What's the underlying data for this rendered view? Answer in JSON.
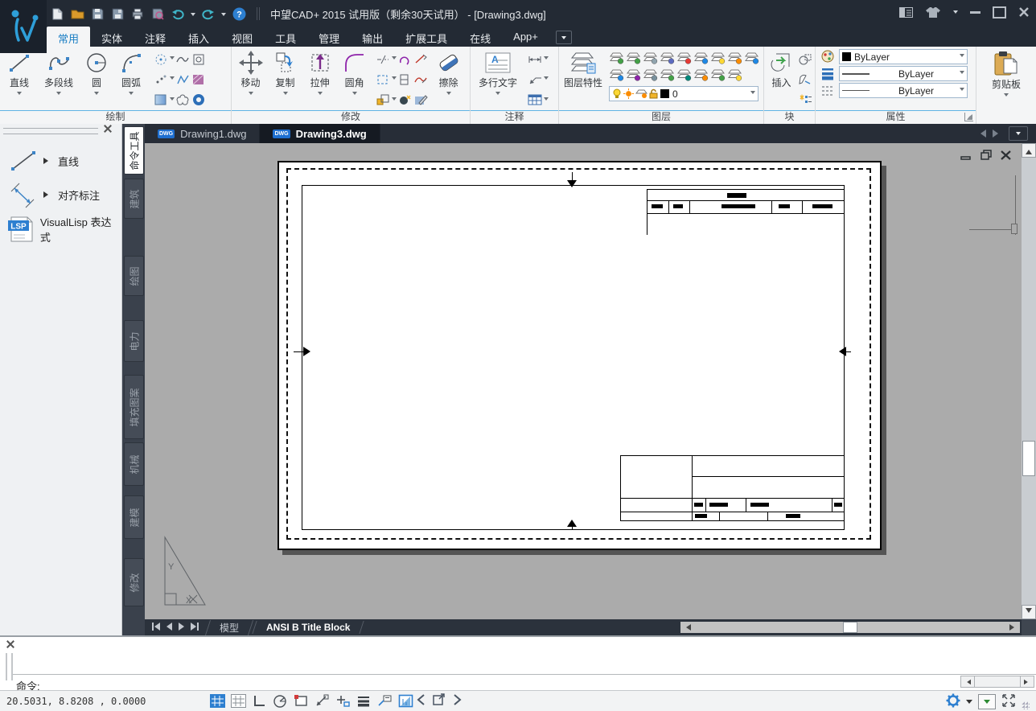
{
  "window": {
    "title": "中望CAD+ 2015 试用版（剩余30天试用） - [Drawing3.dwg]"
  },
  "icons": {
    "help": "?",
    "lsp": "LSP",
    "dwg": "DWG",
    "mtext_a": "A",
    "axis_y": "Y",
    "axis_x": "X"
  },
  "ribbon": {
    "tabs": [
      {
        "id": "home",
        "label": "常用",
        "active": true
      },
      {
        "id": "solid",
        "label": "实体"
      },
      {
        "id": "annotate",
        "label": "注释"
      },
      {
        "id": "insert",
        "label": "插入"
      },
      {
        "id": "view",
        "label": "视图"
      },
      {
        "id": "tools",
        "label": "工具"
      },
      {
        "id": "manage",
        "label": "管理"
      },
      {
        "id": "output",
        "label": "输出"
      },
      {
        "id": "express",
        "label": "扩展工具"
      },
      {
        "id": "online",
        "label": "在线"
      },
      {
        "id": "app",
        "label": "App+"
      }
    ],
    "draw": {
      "label": "绘制",
      "line": "直线",
      "polyline": "多段线",
      "circle": "圆",
      "arc": "圆弧"
    },
    "modify": {
      "label": "修改",
      "move": "移动",
      "copy": "复制",
      "stretch": "拉伸",
      "fillet": "圆角",
      "erase": "擦除"
    },
    "annotate_panel": {
      "label": "注释",
      "mtext": "多行文字"
    },
    "layers": {
      "label": "图层",
      "properties_btn": "图层特性",
      "combo_value": "0",
      "row1_badges": [
        "#43a047",
        "#43a047",
        "#90a4ae",
        "#5c6bc0",
        "#e53935",
        "#1e88e5",
        "#fdd835",
        "#fb8c00",
        "#1e88e5"
      ],
      "row2_badges": [
        "#1e88e5",
        "#8e24aa",
        "#78909c",
        "#43a047",
        "#00897b",
        "#fb8c00",
        "#43a047",
        "#fdd835"
      ]
    },
    "block": {
      "label": "块",
      "insert": "插入"
    },
    "properties": {
      "label": "属性",
      "color": "ByLayer",
      "lineweight": "ByLayer",
      "linetype": "ByLayer"
    },
    "clipboard": {
      "label": "剪贴板"
    }
  },
  "palette": {
    "items": [
      {
        "label": "直线"
      },
      {
        "label": "对齐标注"
      },
      {
        "label": "VisualLisp 表达式",
        "badge": "LSP"
      }
    ]
  },
  "side_tabs": {
    "items": [
      {
        "label": "命令工具",
        "active": true
      },
      {
        "label": "建筑"
      },
      {
        "label": "绘图"
      },
      {
        "label": "电力"
      },
      {
        "label": "填充图案"
      },
      {
        "label": "机械"
      },
      {
        "label": "建模"
      },
      {
        "label": "修改"
      }
    ]
  },
  "doc_tabs": [
    {
      "label": "Drawing1.dwg"
    },
    {
      "label": "Drawing3.dwg",
      "active": true
    }
  ],
  "layout_tabs": {
    "model": "模型",
    "layout": "ANSI B Title Block"
  },
  "command": {
    "prompt": "命令:"
  },
  "status": {
    "coords": "20.5031, 8.8208 , 0.0000"
  },
  "colors": {
    "accent": "#2d7fd0",
    "titlebar": "#232a34",
    "canvas": "#ababab",
    "panel_line": "#5fb4e5"
  }
}
